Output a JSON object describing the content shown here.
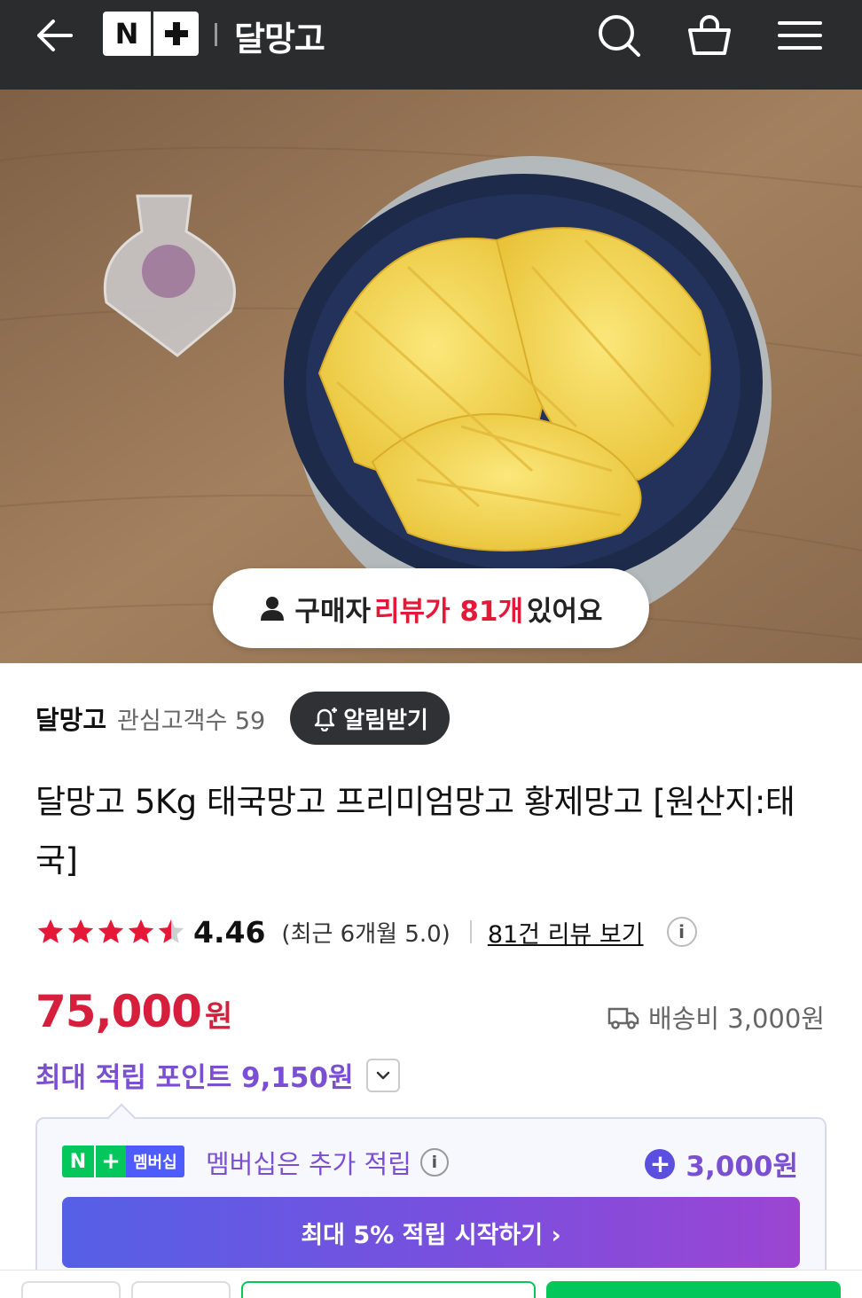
{
  "header": {
    "back_icon": "arrow-left-icon",
    "logo_letter": "N",
    "store_title": "달망고",
    "icons": [
      "search-icon",
      "shopping-bag-icon",
      "menu-icon"
    ],
    "background": "#2b2c2e"
  },
  "hero": {
    "review_prefix": "구매자",
    "review_highlight": "리뷰가 81개",
    "review_suffix": "있어요",
    "highlight_color": "#e51937"
  },
  "store": {
    "name": "달망고",
    "fans_label": "관심고객수 59",
    "notify_label": "알림받기"
  },
  "product": {
    "title": "달망고 5Kg 태국망고 프리미엄망고 황제망고 [원산지:태국]"
  },
  "rating": {
    "stars": 4.46,
    "value": "4.46",
    "recent": "(최근 6개월 5.0)",
    "review_link": "81건 리뷰 보기",
    "info": "i",
    "star_color": "#e51937"
  },
  "price": {
    "amount": "75,000",
    "currency": "원",
    "shipping": "배송비 3,000원",
    "color": "#d51f3c"
  },
  "points": {
    "label": "최대 적립 포인트 9,150원"
  },
  "membership": {
    "badge_n": "N",
    "badge_plus": "+",
    "badge_label": "멤버십",
    "text": "멤버십은 추가 적립",
    "info": "i",
    "amount": "3,000원",
    "cta": "최대 5% 적립 시작하기 ›",
    "accent": "#7b4fd1"
  }
}
